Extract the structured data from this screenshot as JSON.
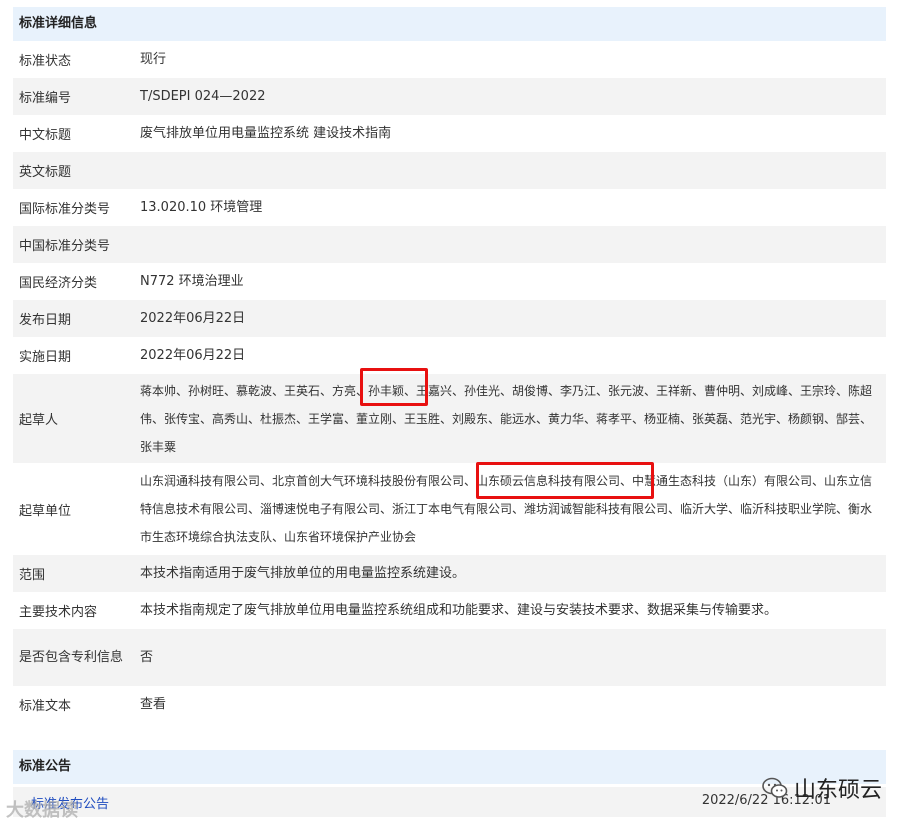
{
  "section_title": "标准详细信息",
  "rows": [
    {
      "label": "标准状态",
      "value": "现行"
    },
    {
      "label": "标准编号",
      "value": "T/SDEPI 024—2022"
    },
    {
      "label": "中文标题",
      "value": "废气排放单位用电量监控系统 建设技术指南"
    },
    {
      "label": "英文标题",
      "value": ""
    },
    {
      "label": "国际标准分类号",
      "value": "13.020.10 环境管理"
    },
    {
      "label": "中国标准分类号",
      "value": ""
    },
    {
      "label": "国民经济分类",
      "value": "N772 环境治理业"
    },
    {
      "label": "发布日期",
      "value": "2022年06月22日"
    },
    {
      "label": "实施日期",
      "value": "2022年06月22日"
    },
    {
      "label": "起草人",
      "value": "蒋本帅、孙树旺、慕乾波、王英石、方亮、孙丰颖、王嘉兴、孙佳光、胡俊博、李乃江、张元波、王祥新、曹仲明、刘成峰、王宗玲、陈超伟、张传宝、高秀山、杜振杰、王学富、董立刚、王玉胜、刘殿东、能远水、黄力华、蒋孝平、杨亚楠、张英磊、范光宇、杨颜钢、郜芸、张丰粟"
    },
    {
      "label": "起草单位",
      "value": "山东润通科技有限公司、北京首创大气环境科技股份有限公司、山东硕云信息科技有限公司、中慧通生态科技（山东）有限公司、山东立信特信息技术有限公司、淄博速悦电子有限公司、浙江丁本电气有限公司、潍坊润诚智能科技有限公司、临沂大学、临沂科技职业学院、衡水市生态环境综合执法支队、山东省环境保护产业协会"
    },
    {
      "label": "范围",
      "value": "本技术指南适用于废气排放单位的用电量监控系统建设。"
    },
    {
      "label": "主要技术内容",
      "value": "本技术指南规定了废气排放单位用电量监控系统组成和功能要求、建设与安装技术要求、数据采集与传输要求。"
    },
    {
      "label": "是否包含专利信息",
      "value": "否"
    },
    {
      "label": "标准文本",
      "value": "查看"
    }
  ],
  "notice": {
    "title": "标准公告",
    "link": "标准发布公告",
    "date": "2022/6/22 16:12:01"
  },
  "brand": "山东硕云",
  "watermark": "大数据读"
}
